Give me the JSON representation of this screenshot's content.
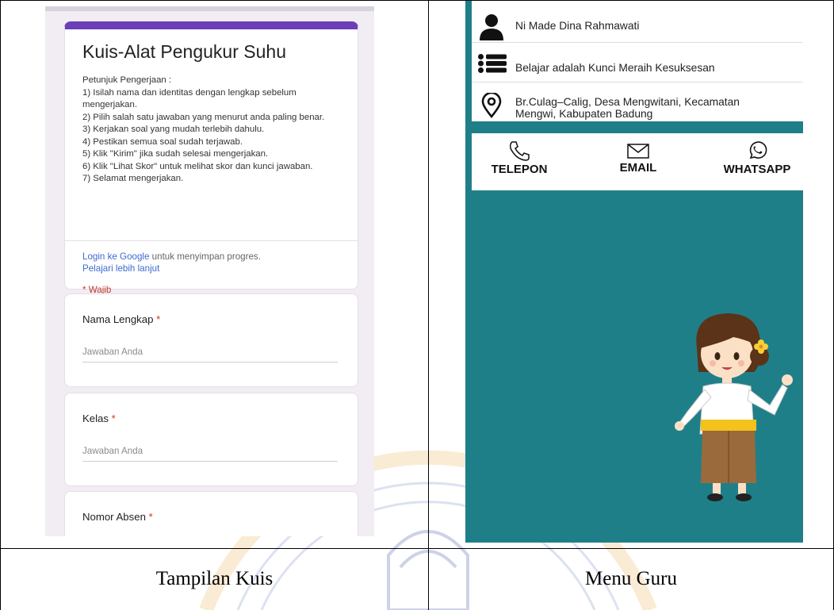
{
  "quiz": {
    "title": "Kuis-Alat Pengukur Suhu",
    "instructions": [
      "Petunjuk Pengerjaan :",
      "1) Isilah nama dan identitas dengan lengkap sebelum mengerjakan.",
      "2) Pilih salah satu jawaban yang menurut anda paling benar.",
      "3) Kerjakan soal yang mudah terlebih dahulu.",
      "4) Pestikan semua soal sudah terjawab.",
      "5) Klik \"Kirim\" jika sudah selesai mengerjakan.",
      "6) Klik \"Lihat Skor\" untuk melihat skor dan kunci jawaban.",
      "7) Selamat mengerjakan."
    ],
    "login_link": "Login ke Google",
    "login_suffix": " untuk menyimpan progres.",
    "learn_more": "Pelajari lebih lanjut",
    "required_note": "* Wajib",
    "questions": [
      {
        "label": "Nama Lengkap",
        "star": " *",
        "placeholder": "Jawaban Anda"
      },
      {
        "label": "Kelas",
        "star": " *",
        "placeholder": "Jawaban Anda"
      },
      {
        "label": "Nomor Absen",
        "star": " *"
      }
    ]
  },
  "teacher": {
    "name": "Ni Made Dina Rahmawati",
    "motto": "Belajar adalah Kunci Meraih Kesuksesan",
    "address_line1": "Br.Culag–Calig, Desa Mengwitani, Kecamatan",
    "address_line2": "Mengwi, Kabupaten Badung",
    "contacts": {
      "phone": "TELEPON",
      "email": "EMAIL",
      "whatsapp": "WHATSAPP"
    },
    "icons": [
      "user-icon",
      "list-icon",
      "location-pin-icon",
      "phone-icon",
      "envelope-icon",
      "whatsapp-icon"
    ],
    "background_color": "#1f7f89"
  },
  "captions": {
    "left": "Tampilan Kuis",
    "right": "Menu Guru"
  },
  "colors": {
    "form_accent": "#6a3fb7",
    "link": "#3f6ad2",
    "required": "#d93025"
  }
}
